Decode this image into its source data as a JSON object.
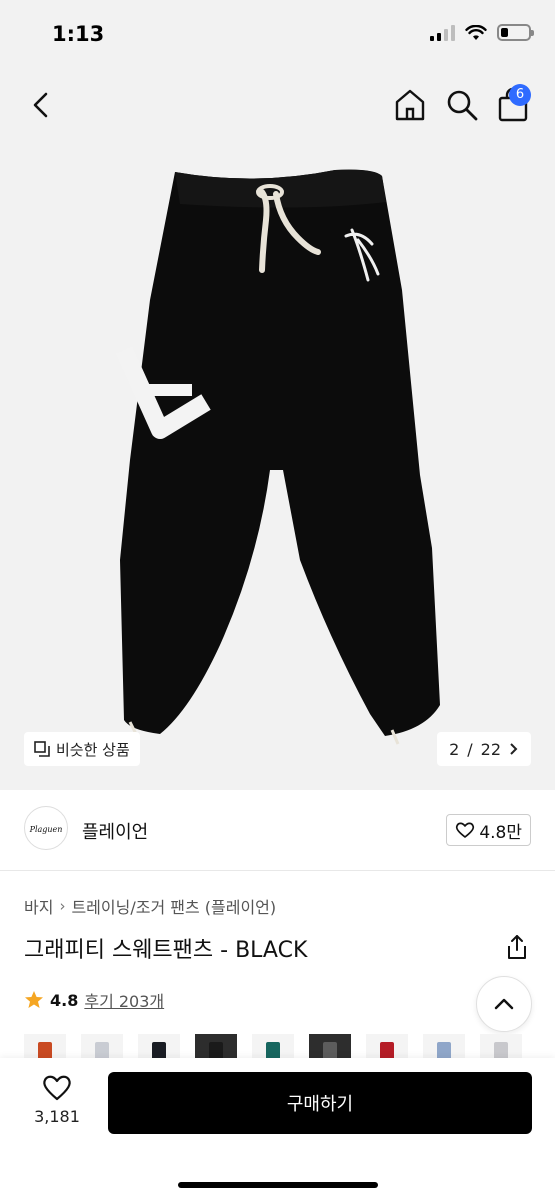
{
  "status": {
    "time": "1:13",
    "battery_level": 0.25
  },
  "nav": {
    "cart_badge": "6"
  },
  "image": {
    "similar_label": "비슷한 상품",
    "page_current": "2",
    "page_sep": "/",
    "page_total": "22"
  },
  "brand": {
    "name": "플레이언",
    "logo_text": "Plaguen",
    "like_count": "4.8만"
  },
  "breadcrumb": [
    "바지",
    "트레이닝/조거 팬츠 (플레이언)"
  ],
  "product": {
    "title": "그래피티 스웨트팬츠 - BLACK",
    "rating": "4.8",
    "reviews": "후기 203개"
  },
  "swatches": [
    "#c94a22",
    "#c9ccd3",
    "#1a1d24",
    "#1a1a1a",
    "#17665f",
    "#5c5c5c",
    "#b51d27",
    "#8fa6c9",
    "#c8c8cc"
  ],
  "bottom": {
    "wish_count": "3,181",
    "buy_label": "구매하기"
  },
  "colors": {
    "accent": "#2f6bff",
    "star": "#f5a623",
    "buy": "#000000"
  }
}
